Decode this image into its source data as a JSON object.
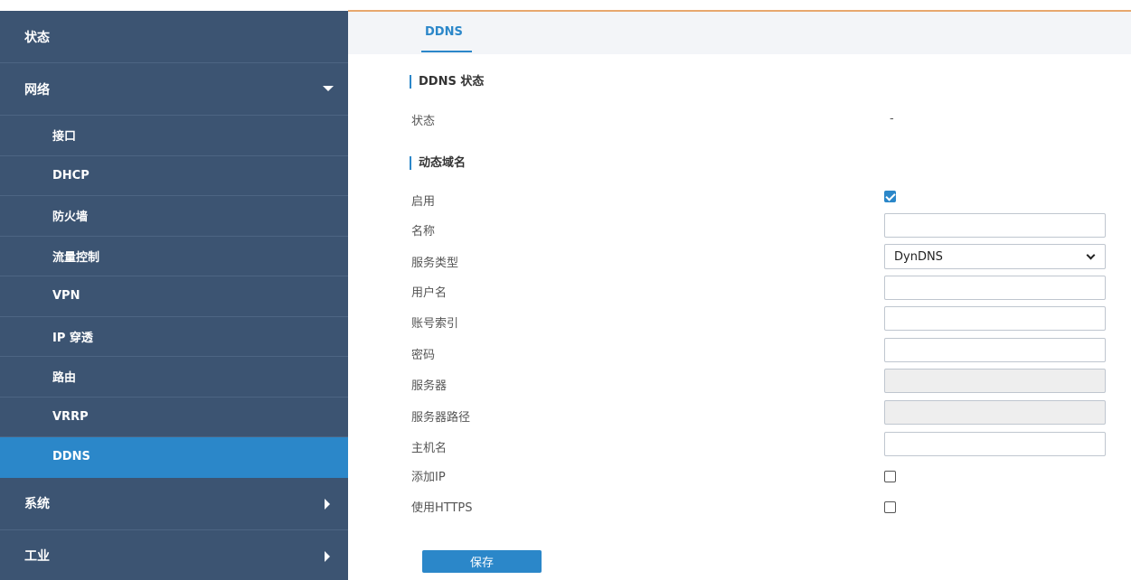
{
  "sidebar": {
    "status": "状态",
    "network": "网络",
    "network_items": [
      {
        "label": "接口"
      },
      {
        "label": "DHCP"
      },
      {
        "label": "防火墙"
      },
      {
        "label": "流量控制"
      },
      {
        "label": "VPN"
      },
      {
        "label": "IP 穿透"
      },
      {
        "label": "路由"
      },
      {
        "label": "VRRP"
      },
      {
        "label": "DDNS",
        "active": true
      }
    ],
    "system": "系统",
    "industrial": "工业"
  },
  "tabs": [
    {
      "label": "DDNS",
      "active": true
    }
  ],
  "ddns_status": {
    "title": "DDNS 状态",
    "status_label": "状态",
    "status_value": "-"
  },
  "dynamic_domain": {
    "title": "动态域名",
    "fields": {
      "enable": {
        "label": "启用",
        "checked": true
      },
      "name": {
        "label": "名称",
        "value": ""
      },
      "service_type": {
        "label": "服务类型",
        "value": "DynDNS"
      },
      "username": {
        "label": "用户名",
        "value": ""
      },
      "account_index": {
        "label": "账号索引",
        "value": ""
      },
      "password": {
        "label": "密码",
        "value": ""
      },
      "server": {
        "label": "服务器",
        "value": ""
      },
      "server_path": {
        "label": "服务器路径",
        "value": ""
      },
      "hostname": {
        "label": "主机名",
        "value": ""
      },
      "add_ip": {
        "label": "添加IP",
        "checked": false
      },
      "use_https": {
        "label": "使用HTTPS",
        "checked": false
      }
    }
  },
  "save_label": "保存",
  "colors": {
    "sidebar_bg": "#3c5472",
    "active_bg": "#2b87c9",
    "accent_line": "#e8a86e"
  }
}
